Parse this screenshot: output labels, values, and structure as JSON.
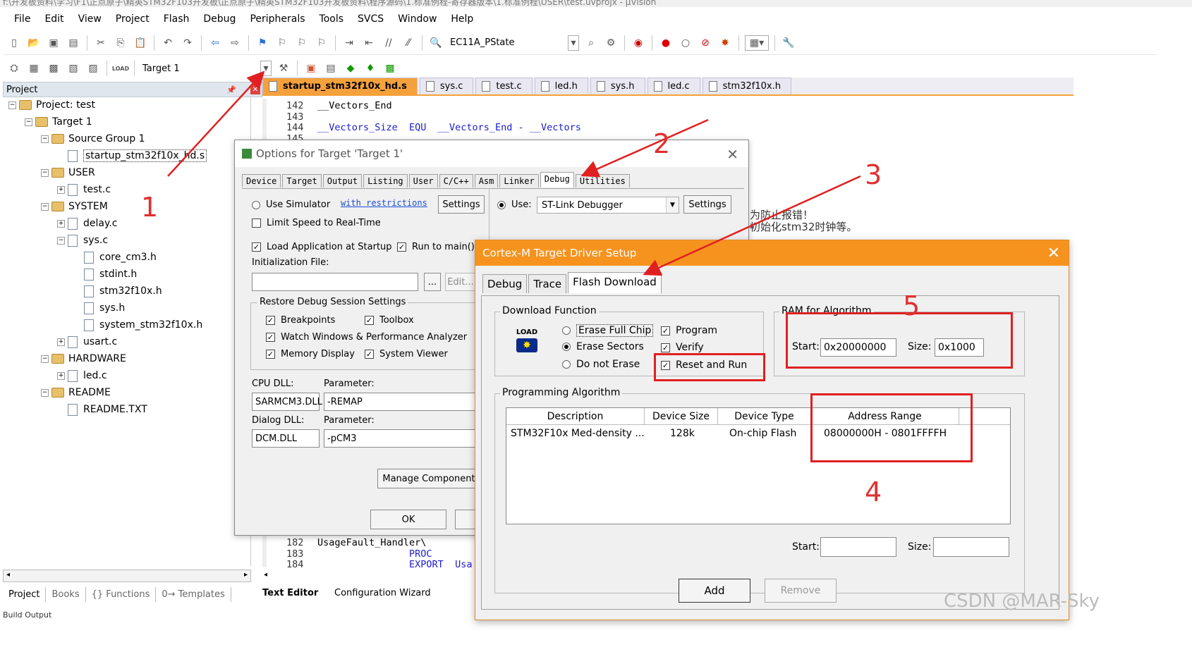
{
  "window": {
    "title_fragment": "f:\\开发板资料\\学习\\F1\\正点原子\\精英STM32F103开发板\\正点原子\\精英STM32F103开发板资料\\程序源码\\1.标准例程-寄存器版本\\1.标准例程\\USER\\test.uvprojx - µVision"
  },
  "menu": [
    "File",
    "Edit",
    "View",
    "Project",
    "Flash",
    "Debug",
    "Peripherals",
    "Tools",
    "SVCS",
    "Window",
    "Help"
  ],
  "toolbar": {
    "target_combo": "EC11A_PState",
    "build_target": "Target 1",
    "load_label": "LOAD"
  },
  "project_panel": {
    "title": "Project",
    "tree": [
      {
        "label": "Project: test",
        "level": 0,
        "kind": "root",
        "expander": "−"
      },
      {
        "label": "Target 1",
        "level": 1,
        "kind": "folder",
        "expander": "−"
      },
      {
        "label": "Source Group 1",
        "level": 2,
        "kind": "folder",
        "expander": "−"
      },
      {
        "label": "startup_stm32f10x_hd.s",
        "level": 3,
        "kind": "file",
        "expander": ""
      },
      {
        "label": "USER",
        "level": 2,
        "kind": "folder",
        "expander": "−"
      },
      {
        "label": "test.c",
        "level": 3,
        "kind": "file",
        "expander": "+"
      },
      {
        "label": "SYSTEM",
        "level": 2,
        "kind": "folder",
        "expander": "−"
      },
      {
        "label": "delay.c",
        "level": 3,
        "kind": "file",
        "expander": "+"
      },
      {
        "label": "sys.c",
        "level": 3,
        "kind": "file",
        "expander": "−"
      },
      {
        "label": "core_cm3.h",
        "level": 4,
        "kind": "file",
        "expander": ""
      },
      {
        "label": "stdint.h",
        "level": 4,
        "kind": "file",
        "expander": ""
      },
      {
        "label": "stm32f10x.h",
        "level": 4,
        "kind": "file",
        "expander": ""
      },
      {
        "label": "sys.h",
        "level": 4,
        "kind": "file",
        "expander": ""
      },
      {
        "label": "system_stm32f10x.h",
        "level": 4,
        "kind": "file",
        "expander": ""
      },
      {
        "label": "usart.c",
        "level": 3,
        "kind": "file",
        "expander": "+"
      },
      {
        "label": "HARDWARE",
        "level": 2,
        "kind": "folder",
        "expander": "−"
      },
      {
        "label": "led.c",
        "level": 3,
        "kind": "file",
        "expander": "+"
      },
      {
        "label": "README",
        "level": 2,
        "kind": "folder",
        "expander": "−"
      },
      {
        "label": "README.TXT",
        "level": 3,
        "kind": "file",
        "expander": ""
      }
    ],
    "bottom_tabs": [
      "Project",
      "Books",
      "{} Functions",
      "0→ Templates"
    ]
  },
  "editor": {
    "tabs": [
      "startup_stm32f10x_hd.s",
      "sys.c",
      "test.c",
      "led.h",
      "sys.h",
      "led.c",
      "stm32f10x.h"
    ],
    "active_tab": 0,
    "lines_top": [
      {
        "n": "142",
        "code": "__Vectors_End"
      },
      {
        "n": "143",
        "code": ""
      },
      {
        "n": "144",
        "code": "__Vectors_Size  EQU  __Vectors_End - __Vectors"
      },
      {
        "n": "145",
        "code": ""
      }
    ],
    "lines_bottom": [
      {
        "n": "182",
        "code": "UsageFault_Handler\\"
      },
      {
        "n": "183",
        "code": "                PROC"
      },
      {
        "n": "184",
        "code": "                EXPORT  Usa"
      }
    ],
    "cjk_fragment_1": "为防止报错！",
    "cjk_fragment_2": "初始化stm32时钟等。",
    "bottom_tabs": [
      "Text Editor",
      "Configuration Wizard"
    ]
  },
  "options_dialog": {
    "title": "Options for Target 'Target 1'",
    "tabs": [
      "Device",
      "Target",
      "Output",
      "Listing",
      "User",
      "C/C++",
      "Asm",
      "Linker",
      "Debug",
      "Utilities"
    ],
    "active_tab": "Debug",
    "use_simulator": "Use Simulator",
    "with_restrictions": "with restrictions",
    "settings": "Settings",
    "limit_speed": "Limit Speed to Real-Time",
    "use": "Use:",
    "debugger": "ST-Link Debugger",
    "load_app": "Load Application at Startup",
    "run_to_main": "Run to main()",
    "init_file": "Initialization File:",
    "ellipsis": "...",
    "edit": "Edit...",
    "restore_group": "Restore Debug Session Settings",
    "breakpoints": "Breakpoints",
    "toolbox": "Toolbox",
    "watch_windows": "Watch Windows & Performance Analyzer",
    "memory_display": "Memory Display",
    "system_viewer": "System Viewer",
    "cpu_dll_label": "CPU DLL:",
    "parameter_label": "Parameter:",
    "cpu_dll": "SARMCM3.DLL",
    "cpu_param": "-REMAP",
    "dialog_dll_label": "Dialog DLL:",
    "dialog_dll": "DCM.DLL",
    "dialog_param": "-pCM3",
    "manage": "Manage Component",
    "ok": "OK"
  },
  "cortex_dialog": {
    "title": "Cortex-M Target Driver Setup",
    "tabs": [
      "Debug",
      "Trace",
      "Flash Download"
    ],
    "active_tab": "Flash Download",
    "download_function": "Download Function",
    "load_icon": "LOAD",
    "erase_full": "Erase Full Chip",
    "erase_sectors": "Erase Sectors",
    "do_not_erase": "Do not Erase",
    "program": "Program",
    "verify": "Verify",
    "reset_and_run": "Reset and Run",
    "ram_group": "RAM for Algorithm",
    "start_label": "Start:",
    "start_value": "0x20000000",
    "size_label": "Size:",
    "size_value": "0x1000",
    "prog_algo": "Programming Algorithm",
    "columns": [
      "Description",
      "Device Size",
      "Device Type",
      "Address Range"
    ],
    "rows": [
      [
        "STM32F10x Med-density ...",
        "128k",
        "On-chip Flash",
        "08000000H - 0801FFFFH"
      ]
    ],
    "start2_label": "Start:",
    "size2_label": "Size:",
    "add": "Add",
    "remove": "Remove"
  },
  "annotations": [
    "1",
    "2",
    "3",
    "4",
    "5"
  ],
  "watermark": "CSDN @MAR-Sky",
  "build_output": "Build Output"
}
